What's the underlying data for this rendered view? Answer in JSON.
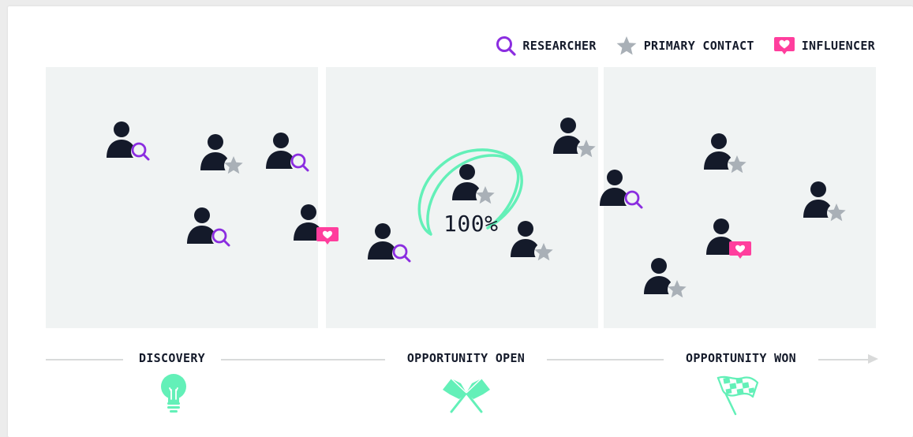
{
  "legend": {
    "researcher": "RESEARCHER",
    "primary_contact": "PRIMARY CONTACT",
    "influencer": "INFLUENCER"
  },
  "colors": {
    "researcher": "#8b2de0",
    "primary_contact": "#a9b0b7",
    "influencer": "#ff3e9d",
    "person": "#141a2a",
    "accent": "#63f0b8",
    "panel": "#f0f3f3"
  },
  "highlight": {
    "percent": "100%"
  },
  "stages": [
    {
      "label": "DISCOVERY",
      "icon": "lightbulb-icon"
    },
    {
      "label": "OPPORTUNITY OPEN",
      "icon": "crossed-flags-icon"
    },
    {
      "label": "OPPORTUNITY WON",
      "icon": "checkered-flag-icon"
    }
  ],
  "people": [
    {
      "stage": "discovery",
      "role": "researcher"
    },
    {
      "stage": "discovery",
      "role": "primary_contact"
    },
    {
      "stage": "discovery",
      "role": "researcher"
    },
    {
      "stage": "discovery",
      "role": "researcher"
    },
    {
      "stage": "discovery",
      "role": "influencer"
    },
    {
      "stage": "opportunity_open",
      "role": "researcher"
    },
    {
      "stage": "opportunity_open",
      "role": "primary_contact",
      "highlighted": true
    },
    {
      "stage": "opportunity_open",
      "role": "primary_contact"
    },
    {
      "stage": "opportunity_open",
      "role": "primary_contact"
    },
    {
      "stage": "opportunity_open",
      "role": "researcher"
    },
    {
      "stage": "opportunity_won",
      "role": "primary_contact"
    },
    {
      "stage": "opportunity_won",
      "role": "primary_contact"
    },
    {
      "stage": "opportunity_won",
      "role": "influencer"
    },
    {
      "stage": "opportunity_won",
      "role": "primary_contact"
    }
  ]
}
